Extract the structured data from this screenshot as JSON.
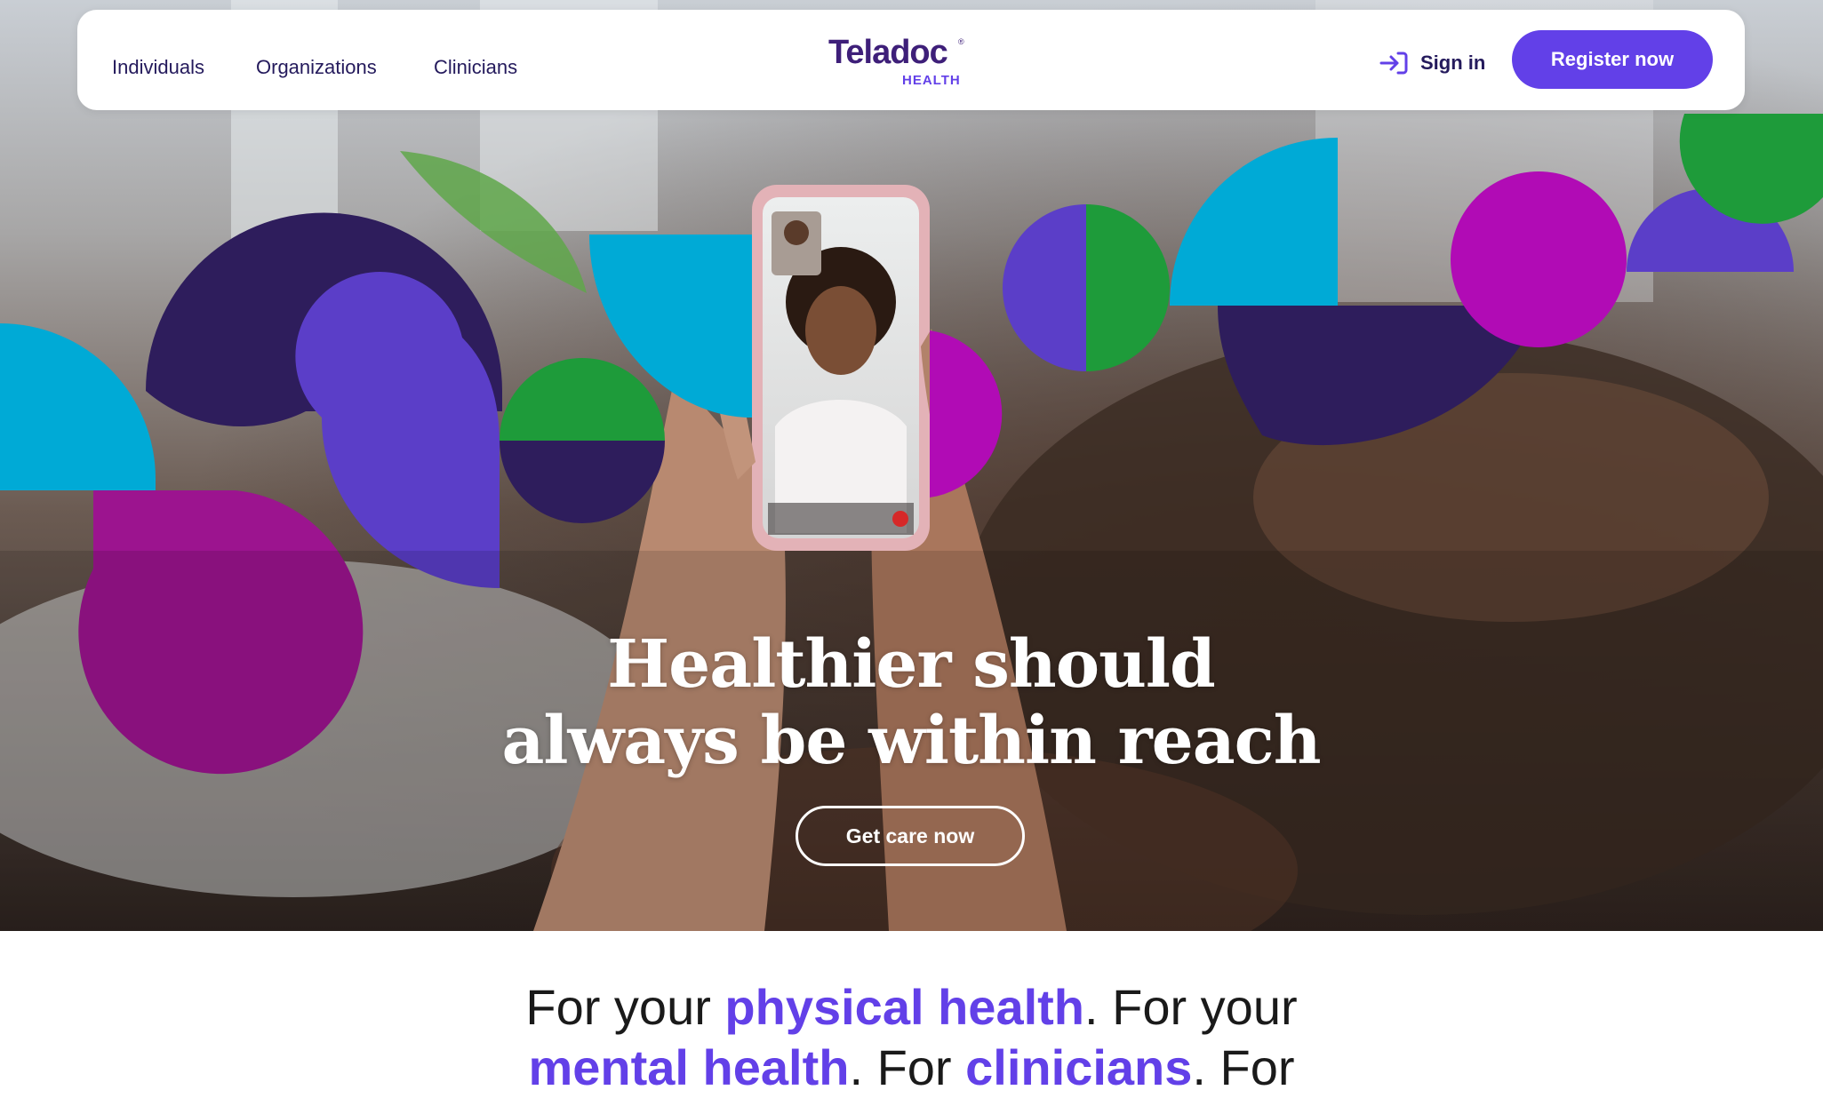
{
  "nav": {
    "links": [
      "Individuals",
      "Organizations",
      "Clinicians"
    ],
    "logo": {
      "word": "Teladoc",
      "sub": "HEALTH",
      "mark": "®"
    },
    "sign_in": "Sign in",
    "register": "Register now"
  },
  "hero": {
    "headline_line1": "Healthier should",
    "headline_line2": "always be within reach",
    "cta": "Get care now"
  },
  "tagline": {
    "p1": "For your ",
    "h1": "physical health",
    "p2": ". For your",
    "h2": "mental health",
    "p3": ". For ",
    "h3": "clinicians",
    "p4": ". For"
  },
  "colors": {
    "brand_purple": "#6240e8",
    "deep_purple": "#2e1d5c",
    "violet": "#5b3ec8",
    "cyan": "#00aad6",
    "green": "#1e9b3a",
    "magenta": "#b10bb5",
    "text_dark": "#241a5c"
  },
  "icons": {
    "sign_in": "sign-in-arrow-icon"
  }
}
